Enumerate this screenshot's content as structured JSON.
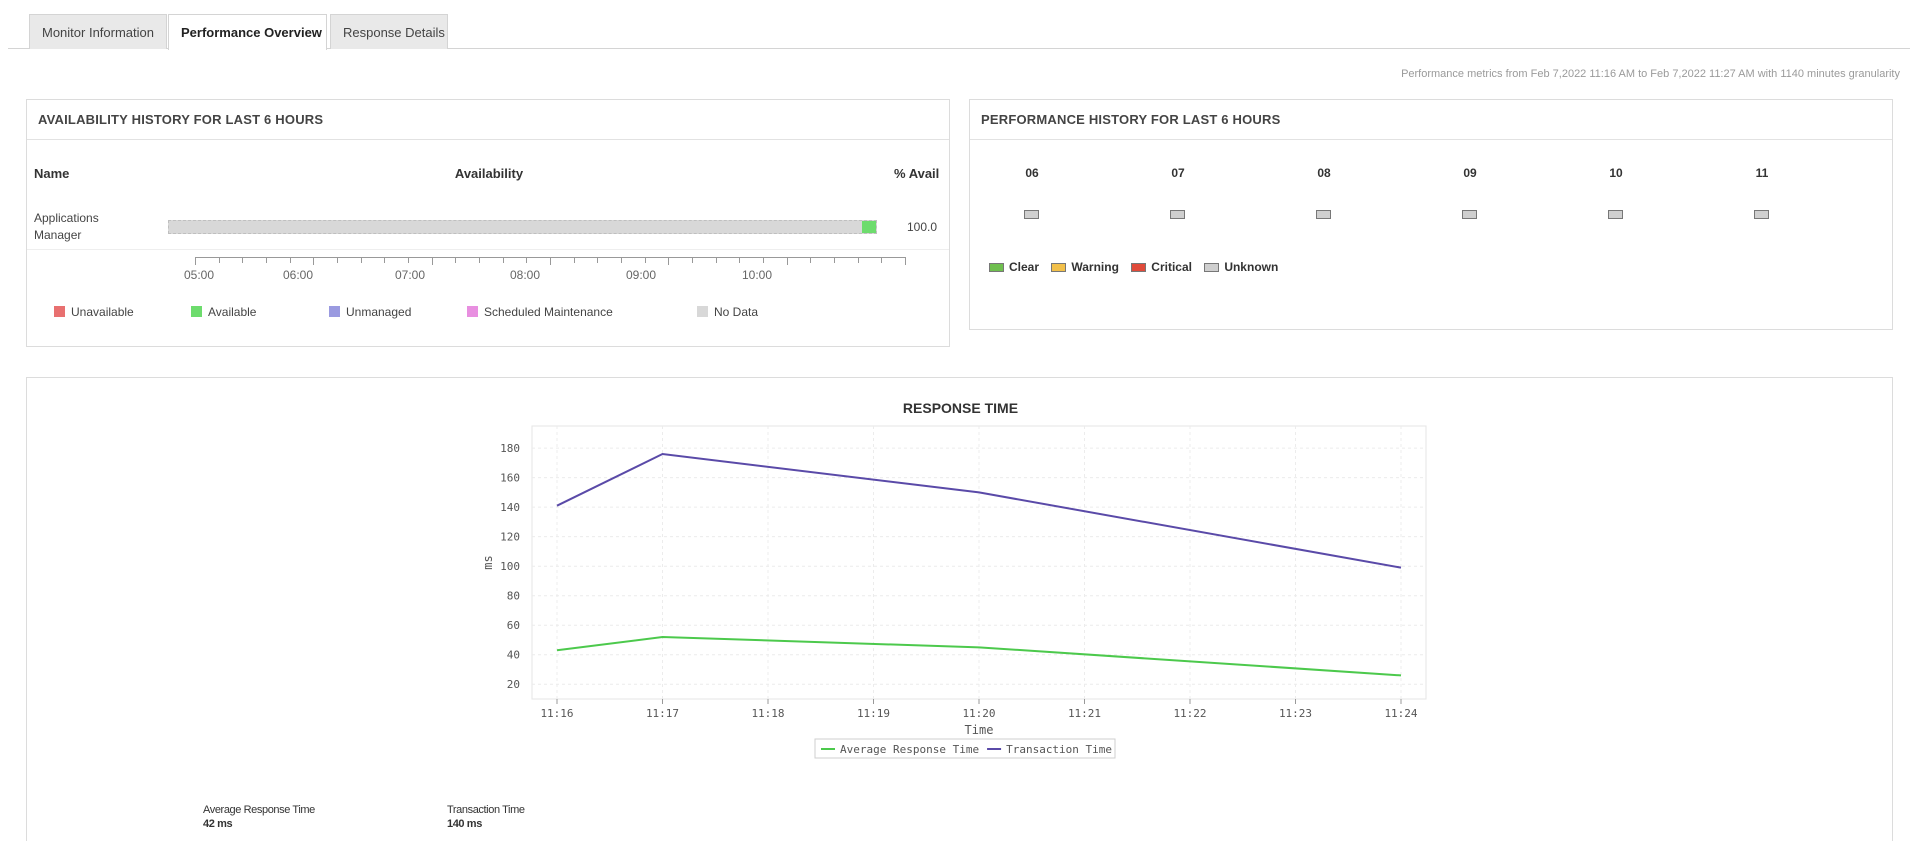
{
  "tabs": [
    {
      "label": "Monitor Information"
    },
    {
      "label": "Performance Overview"
    },
    {
      "label": "Response Details"
    }
  ],
  "metrics_note": "Performance metrics from Feb 7,2022 11:16 AM to Feb 7,2022 11:27 AM with 1140 minutes granularity",
  "availability": {
    "title": "AVAILABILITY HISTORY FOR LAST 6 HOURS",
    "col_name": "Name",
    "col_availability": "Availability",
    "col_avail_pct": "% Avail",
    "row_name_line1": "Applications",
    "row_name_line2": "Manager",
    "row_value": "100.0",
    "available_fraction": 0.02,
    "axis_labels": [
      "05:00",
      "06:00",
      "07:00",
      "08:00",
      "09:00",
      "10:00"
    ],
    "legend": [
      {
        "label": "Unavailable",
        "color": "#e87070"
      },
      {
        "label": "Available",
        "color": "#6ddc6d"
      },
      {
        "label": "Unmanaged",
        "color": "#9a9ae0"
      },
      {
        "label": "Scheduled Maintenance",
        "color": "#e88fe0"
      },
      {
        "label": "No Data",
        "color": "#d8d8d8"
      }
    ]
  },
  "performance": {
    "title": "PERFORMANCE HISTORY FOR LAST 6 HOURS",
    "hours": [
      "06",
      "07",
      "08",
      "09",
      "10",
      "11"
    ],
    "legend": [
      {
        "label": "Clear",
        "color": "#6fbf4f"
      },
      {
        "label": "Warning",
        "color": "#f2c04a"
      },
      {
        "label": "Critical",
        "color": "#e04a3a"
      },
      {
        "label": "Unknown",
        "color": "#cfcfcf"
      }
    ]
  },
  "response": {
    "title": "RESPONSE TIME",
    "stats": [
      {
        "label": "Average Response Time",
        "value": "42 ms"
      },
      {
        "label": "Transaction Time",
        "value": "140 ms"
      }
    ]
  },
  "chart_data": {
    "type": "line",
    "title": "RESPONSE TIME",
    "xlabel": "Time",
    "ylabel": "ms",
    "x": [
      "11:16",
      "11:17",
      "11:18",
      "11:19",
      "11:20",
      "11:21",
      "11:22",
      "11:23",
      "11:24"
    ],
    "y_ticks": [
      20,
      40,
      60,
      80,
      100,
      120,
      140,
      160,
      180
    ],
    "ylim": [
      10,
      195
    ],
    "grid": true,
    "legend_position": "bottom",
    "series": [
      {
        "name": "Average Response Time",
        "color": "#4cc94c",
        "points": [
          [
            "11:16",
            43
          ],
          [
            "11:17",
            52
          ],
          [
            "11:20",
            45
          ],
          [
            "11:24",
            26
          ]
        ]
      },
      {
        "name": "Transaction Time",
        "color": "#5a4aa8",
        "points": [
          [
            "11:16",
            141
          ],
          [
            "11:17",
            176
          ],
          [
            "11:20",
            150
          ],
          [
            "11:24",
            99
          ]
        ]
      }
    ]
  }
}
